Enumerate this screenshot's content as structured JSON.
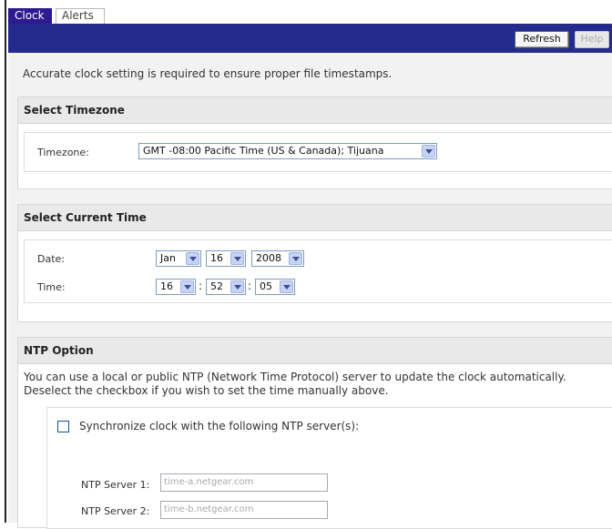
{
  "tabs": {
    "clock": "Clock",
    "alerts": "Alerts"
  },
  "toolbar": {
    "refresh": "Refresh",
    "help": "Help"
  },
  "intro": "Accurate clock setting is required to ensure proper file timestamps.",
  "timezone": {
    "title": "Select Timezone",
    "label": "Timezone:",
    "value": "GMT -08:00 Pacific Time (US & Canada); Tijuana"
  },
  "current_time": {
    "title": "Select Current Time",
    "date_label": "Date:",
    "month": "Jan",
    "day": "16",
    "year": "2008",
    "time_label": "Time:",
    "hour": "16",
    "minute": "52",
    "second": "05",
    "separator": ":"
  },
  "ntp": {
    "title": "NTP Option",
    "desc_line1": "You can use a local or public NTP (Network Time Protocol) server to update the clock automatically.",
    "desc_line2": "Deselect the checkbox if you wish to set the time manually above.",
    "sync_label": "Synchronize clock with the following NTP server(s):",
    "sync_checked": false,
    "server1_label": "NTP Server 1:",
    "server1_value": "time-a.netgear.com",
    "server2_label": "NTP Server 2:",
    "server2_value": "time-b.netgear.com"
  },
  "colors": {
    "toolbar_bg": "#232b8c",
    "active_tab_bg": "#2d1a8e",
    "panel_header_bg": "#e9e9e9",
    "page_bg": "#f2f2f2"
  }
}
